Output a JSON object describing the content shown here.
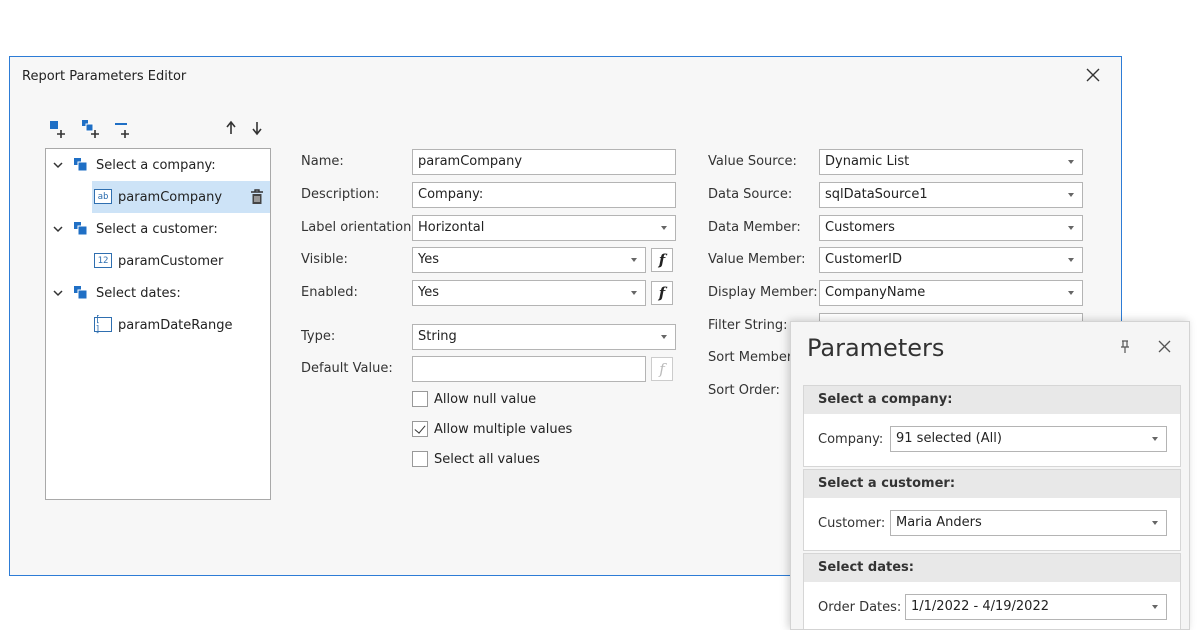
{
  "dialog": {
    "title": "Report Parameters Editor",
    "toolbar": {
      "add_parameter": "add-parameter-icon",
      "add_group": "add-group-icon",
      "add_separator": "add-separator-icon",
      "move_up": "↑",
      "move_down": "↓"
    },
    "tree": [
      {
        "type": "group",
        "label": "Select a company:"
      },
      {
        "type": "param",
        "label": "paramCompany",
        "badge": "ab",
        "selected": true
      },
      {
        "type": "group",
        "label": "Select a customer:"
      },
      {
        "type": "param",
        "label": "paramCustomer",
        "badge": "12"
      },
      {
        "type": "group",
        "label": "Select dates:"
      },
      {
        "type": "param",
        "label": "paramDateRange",
        "badge": "[ ]"
      }
    ],
    "props": {
      "name_label": "Name:",
      "name_value": "paramCompany",
      "description_label": "Description:",
      "description_value": "Company:",
      "orientation_label": "Label orientation:",
      "orientation_value": "Horizontal",
      "visible_label": "Visible:",
      "visible_value": "Yes",
      "enabled_label": "Enabled:",
      "enabled_value": "Yes",
      "type_label": "Type:",
      "type_value": "String",
      "default_label": "Default Value:",
      "default_value": "",
      "fx": "f",
      "allow_null": "Allow null value",
      "allow_null_checked": false,
      "allow_multiple": "Allow multiple values",
      "allow_multiple_checked": true,
      "select_all": "Select all values",
      "select_all_checked": false
    },
    "source": {
      "value_source_label": "Value Source:",
      "value_source_value": "Dynamic List",
      "data_source_label": "Data Source:",
      "data_source_value": "sqlDataSource1",
      "data_member_label": "Data Member:",
      "data_member_value": "Customers",
      "value_member_label": "Value Member:",
      "value_member_value": "CustomerID",
      "display_member_label": "Display Member:",
      "display_member_value": "CompanyName",
      "filter_string_label": "Filter String:",
      "sort_member_label": "Sort Member:",
      "sort_order_label": "Sort Order:"
    }
  },
  "panel": {
    "title": "Parameters",
    "groups": [
      {
        "header": "Select a company:",
        "label": "Company:",
        "value": "91 selected (All)"
      },
      {
        "header": "Select a customer:",
        "label": "Customer:",
        "value": "Maria Anders"
      },
      {
        "header": "Select dates:",
        "label": "Order Dates:",
        "value": "1/1/2022 - 4/19/2022"
      }
    ]
  },
  "colors": {
    "accent": "#2d7cd6",
    "selected": "#cde3f7",
    "icon_blue": "#1f6fc5"
  }
}
